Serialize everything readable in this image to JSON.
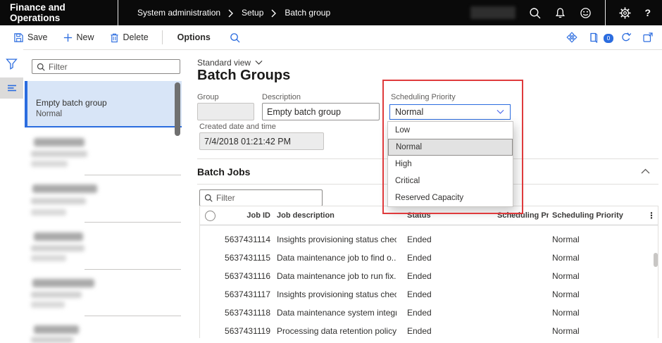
{
  "header": {
    "app_title": "Finance and Operations",
    "breadcrumb": [
      "System administration",
      "Setup",
      "Batch group"
    ],
    "icons": [
      "search-icon",
      "bell-icon",
      "feedback-smiley-icon",
      "settings-gear-icon",
      "help-icon"
    ]
  },
  "action_pane": {
    "save_label": "Save",
    "new_label": "New",
    "delete_label": "Delete",
    "options_label": "Options",
    "right_icons": [
      "view-switcher-icon",
      "attachments-icon",
      "messages-icon",
      "refresh-icon",
      "open-in-new-window-icon"
    ],
    "message_badge_count": "0"
  },
  "sidebar": {
    "filter_placeholder": "Filter",
    "selected_item": {
      "title": "Empty batch group",
      "subtitle": "Normal"
    },
    "redacted_item_count": 5
  },
  "main": {
    "view_selector_label": "Standard view",
    "page_title": "Batch Groups",
    "fields": {
      "group_label": "Group",
      "group_value": "",
      "description_label": "Description",
      "description_value": "Empty batch group",
      "created_label": "Created date and time",
      "created_value": "7/4/2018 01:21:42 PM"
    },
    "scheduling_priority": {
      "label": "Scheduling Priority",
      "selected": "Normal",
      "options": [
        "Low",
        "Normal",
        "High",
        "Critical",
        "Reserved Capacity"
      ]
    },
    "batch_jobs": {
      "section_title": "Batch Jobs",
      "filter_placeholder": "Filter",
      "columns": [
        "Job ID",
        "Job description",
        "Status",
        "Scheduling Pri...",
        "Scheduling Priority"
      ],
      "rows": [
        {
          "job_id": "5637431114",
          "description": "Insights provisioning status check",
          "status": "Ended",
          "scheduling_priority": "Normal"
        },
        {
          "job_id": "5637431115",
          "description": "Data maintenance job to find o...",
          "status": "Ended",
          "scheduling_priority": "Normal"
        },
        {
          "job_id": "5637431116",
          "description": "Data maintenance job to run fix...",
          "status": "Ended",
          "scheduling_priority": "Normal"
        },
        {
          "job_id": "5637431117",
          "description": "Insights provisioning status check",
          "status": "Ended",
          "scheduling_priority": "Normal"
        },
        {
          "job_id": "5637431118",
          "description": "Data maintenance system integr...",
          "status": "Ended",
          "scheduling_priority": "Normal"
        },
        {
          "job_id": "5637431119",
          "description": "Processing data retention policy...",
          "status": "Ended",
          "scheduling_priority": "Normal"
        }
      ]
    }
  },
  "colors": {
    "accent_blue": "#2b6cdf",
    "highlight_red": "#df3a3c",
    "selected_item_bg": "#d8e5f7",
    "topbar_bg": "#0a0a0a"
  }
}
